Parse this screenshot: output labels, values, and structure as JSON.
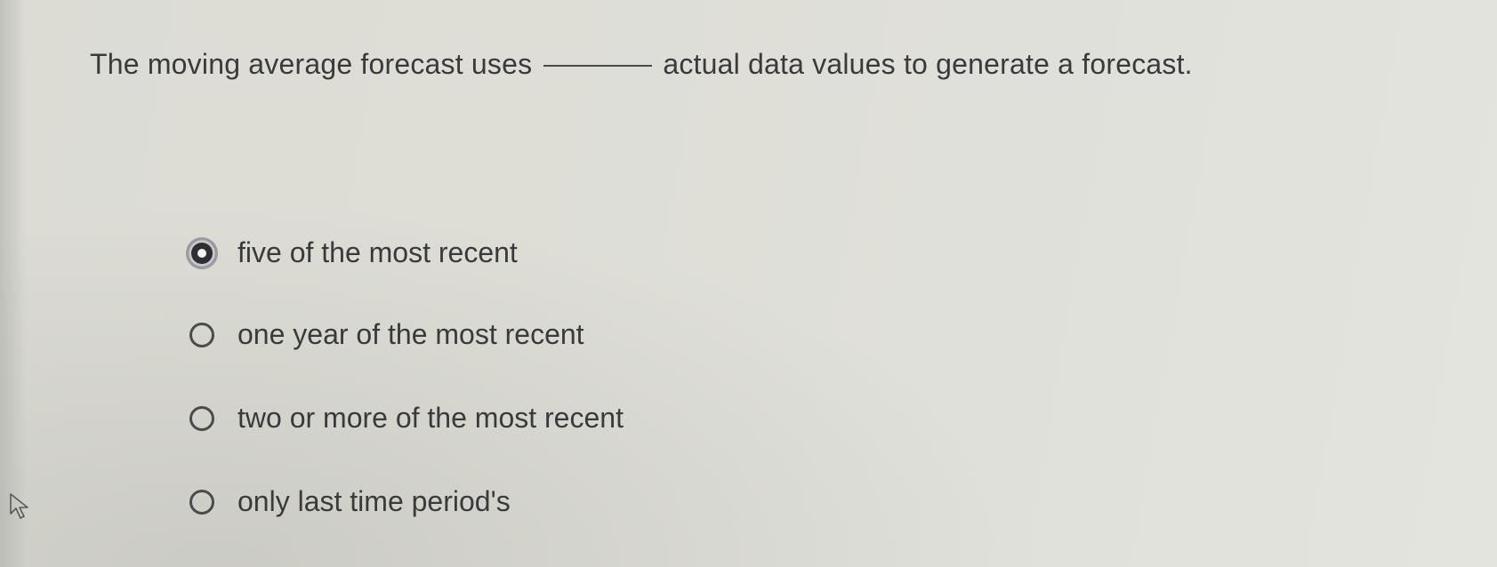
{
  "question": {
    "before_blank": "The moving average forecast uses",
    "after_blank": "actual data values to generate a forecast."
  },
  "options": [
    {
      "label": "five of the most recent",
      "selected": true
    },
    {
      "label": "one year of the most recent",
      "selected": false
    },
    {
      "label": "two or more of the most recent",
      "selected": false
    },
    {
      "label": "only last time period's",
      "selected": false
    }
  ],
  "colors": {
    "background": "#deded8",
    "text": "#3a3a3c",
    "radio_border": "#4b4b4d",
    "radio_selected_fill": "#2f2f32"
  },
  "icons": {
    "pointer": "mouse-pointer-icon"
  }
}
